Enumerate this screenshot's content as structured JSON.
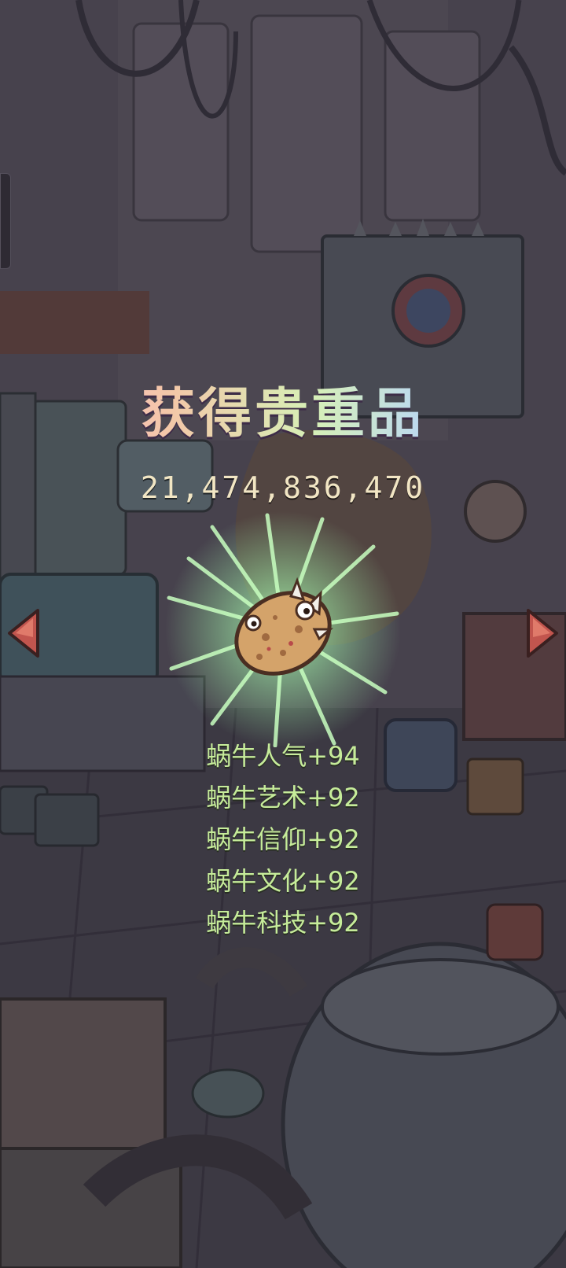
{
  "reward": {
    "title": "获得贵重品",
    "count": "21,474,836,470",
    "item_icon": "potato-snail-item-icon",
    "stats": [
      "蜗牛人气+94",
      "蜗牛艺术+92",
      "蜗牛信仰+92",
      "蜗牛文化+92",
      "蜗牛科技+92"
    ]
  },
  "navigation": {
    "prev_icon": "triangle-left-icon",
    "next_icon": "triangle-right-icon"
  },
  "colors": {
    "title_gradient": [
      "#ffb3d4",
      "#d7f0b6",
      "#b5d2ff",
      "#d9b0ff"
    ],
    "stat_text": "#c6ec9a",
    "count_text": "#f2e6c4",
    "ray_glow": "#a8ffb0"
  }
}
